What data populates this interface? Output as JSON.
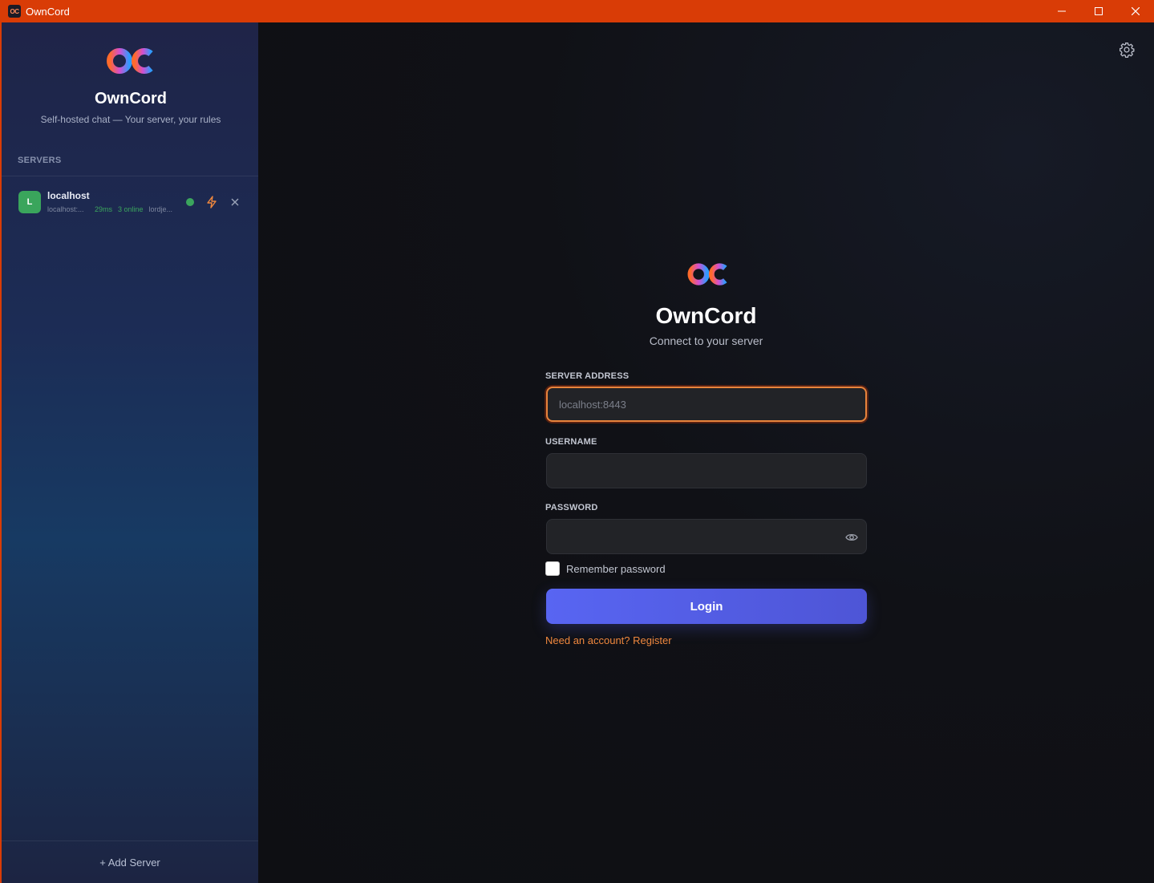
{
  "window": {
    "title": "OwnCord",
    "icon_text": "OC"
  },
  "sidebar": {
    "logo_text": "OC",
    "app_name": "OwnCord",
    "tagline": "Self-hosted chat — Your server, your rules",
    "section_label": "SERVERS",
    "servers": [
      {
        "initial": "L",
        "name": "localhost",
        "host": "localhost:...",
        "ping": "29ms",
        "online": "3 online",
        "user": "lordje..."
      }
    ],
    "add_server_label": "+ Add Server"
  },
  "login": {
    "logo_text": "OC",
    "title": "OwnCord",
    "subtitle": "Connect to your server",
    "server_address_label": "SERVER ADDRESS",
    "server_address_placeholder": "localhost:8443",
    "username_label": "USERNAME",
    "username_value": "",
    "password_label": "PASSWORD",
    "password_value": "",
    "remember_label": "Remember password",
    "remember_checked": false,
    "login_button": "Login",
    "register_link": "Need an account? Register"
  },
  "colors": {
    "titlebar": "#d93c06",
    "accent_button": "#5865f2",
    "link": "#f0883e",
    "online": "#3ba55d",
    "focus_ring": "#e8843c"
  }
}
